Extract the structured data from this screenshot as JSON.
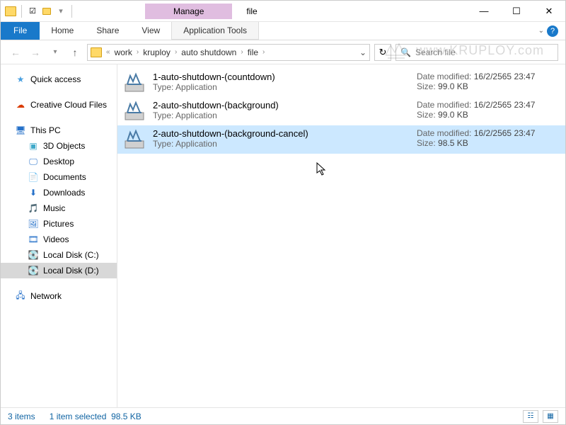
{
  "title_context": "Manage",
  "window_title": "file",
  "tabs": {
    "file": "File",
    "home": "Home",
    "share": "Share",
    "view": "View",
    "app_tools": "Application Tools"
  },
  "breadcrumb": {
    "prefix": "«",
    "parts": [
      "work",
      "kruploy",
      "auto shutdown",
      "file"
    ]
  },
  "search": {
    "placeholder": "Search file"
  },
  "sidebar": {
    "quick_access": "Quick access",
    "creative_cloud": "Creative Cloud Files",
    "this_pc": "This PC",
    "pc_items": [
      "3D Objects",
      "Desktop",
      "Documents",
      "Downloads",
      "Music",
      "Pictures",
      "Videos",
      "Local Disk (C:)",
      "Local Disk (D:)"
    ],
    "network": "Network"
  },
  "files": [
    {
      "name": "1-auto-shutdown-(countdown)",
      "type_label": "Type:",
      "type": "Application",
      "date_label": "Date modified:",
      "date": "16/2/2565 23:47",
      "size_label": "Size:",
      "size": "99.0 KB",
      "selected": false
    },
    {
      "name": "2-auto-shutdown-(background)",
      "type_label": "Type:",
      "type": "Application",
      "date_label": "Date modified:",
      "date": "16/2/2565 23:47",
      "size_label": "Size:",
      "size": "99.0 KB",
      "selected": false
    },
    {
      "name": "2-auto-shutdown-(background-cancel)",
      "type_label": "Type:",
      "type": "Application",
      "date_label": "Date modified:",
      "date": "16/2/2565 23:47",
      "size_label": "Size:",
      "size": "98.5 KB",
      "selected": true
    }
  ],
  "status": {
    "count": "3 items",
    "selection": "1 item selected",
    "size": "98.5 KB"
  },
  "watermark": "www.KRUPLOY.com"
}
